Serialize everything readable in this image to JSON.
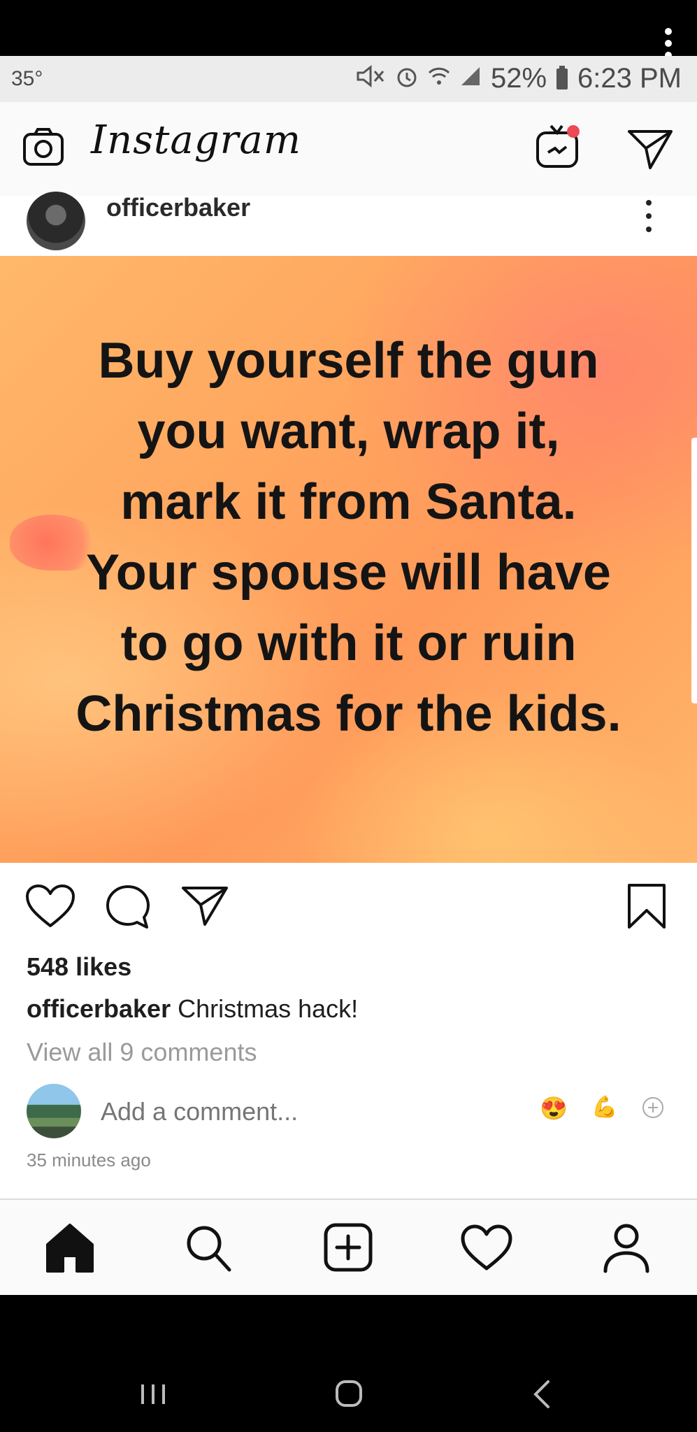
{
  "status_bar": {
    "temperature": "35°",
    "battery": "52%",
    "time": "6:23 PM"
  },
  "header": {
    "app_name": "Instagram",
    "igtv_notification_color": "#ed4956"
  },
  "post": {
    "username": "officerbaker",
    "image_text_lines": [
      "Buy yourself the gun",
      "you want,  wrap it,",
      "mark it from Santa.",
      "Your spouse will have",
      "to go with it or ruin",
      "Christmas for the kids."
    ],
    "likes": "548 likes",
    "caption_user": "officerbaker",
    "caption_text": "Christmas hack!",
    "view_comments": "View all 9 comments",
    "comment_placeholder": "Add a comment...",
    "quick_emojis": [
      "😍",
      "💪"
    ],
    "time_ago": "35 minutes ago"
  },
  "bottom_nav": [
    "home-icon",
    "search-icon",
    "add-post-icon",
    "activity-heart-icon",
    "profile-icon"
  ],
  "colors": {
    "header_bg": "#fafafa",
    "post_bg_orange": "#ffa45e",
    "muted_text": "#9a9a9a",
    "notification_red": "#ed4956"
  }
}
